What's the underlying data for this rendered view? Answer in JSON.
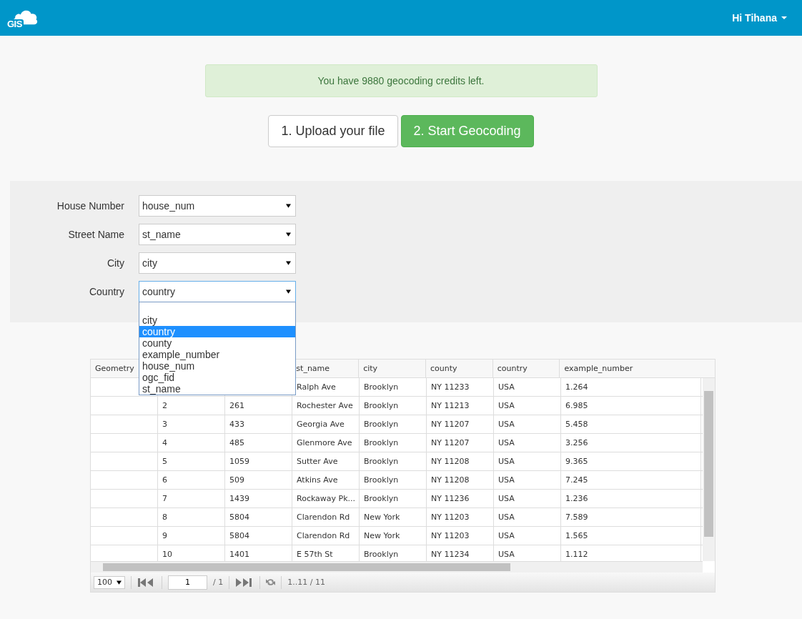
{
  "navbar": {
    "logo": "GIS",
    "user_menu": "Hi Tihana"
  },
  "alert": {
    "text": "You have 9880 geocoding credits left."
  },
  "steps": [
    {
      "label": "1. Upload your file",
      "selected": false
    },
    {
      "label": "2. Start Geocoding",
      "selected": true
    }
  ],
  "form": {
    "fields": [
      {
        "label": "House Number",
        "value": "house_num",
        "focused": false
      },
      {
        "label": "Street Name",
        "value": "st_name",
        "focused": false
      },
      {
        "label": "City",
        "value": "city",
        "focused": false
      },
      {
        "label": "Country",
        "value": "country",
        "focused": true
      }
    ],
    "open_dropdown": {
      "options": [
        {
          "label": "city",
          "selected": false
        },
        {
          "label": "country",
          "selected": true
        },
        {
          "label": "county",
          "selected": false
        },
        {
          "label": "example_number",
          "selected": false
        },
        {
          "label": "house_num",
          "selected": false
        },
        {
          "label": "ogc_fid",
          "selected": false
        },
        {
          "label": "st_name",
          "selected": false
        }
      ]
    }
  },
  "table": {
    "columns": [
      "Geometry",
      null,
      null,
      "st_name",
      "city",
      "county",
      "country",
      "example_number"
    ],
    "rows": [
      [
        null,
        null,
        null,
        "Ralph Ave",
        "Brooklyn",
        "NY 11233",
        "USA",
        "1.264"
      ],
      [
        null,
        "2",
        "261",
        "Rochester Ave",
        "Brooklyn",
        "NY 11213",
        "USA",
        "6.985"
      ],
      [
        null,
        "3",
        "433",
        "Georgia Ave",
        "Brooklyn",
        "NY 11207",
        "USA",
        "5.458"
      ],
      [
        null,
        "4",
        "485",
        "Glenmore Ave",
        "Brooklyn",
        "NY 11207",
        "USA",
        "3.256"
      ],
      [
        null,
        "5",
        "1059",
        "Sutter Ave",
        "Brooklyn",
        "NY 11208",
        "USA",
        "9.365"
      ],
      [
        null,
        "6",
        "509",
        "Atkins Ave",
        "Brooklyn",
        "NY 11208",
        "USA",
        "7.245"
      ],
      [
        null,
        "7",
        "1439",
        "Rockaway Pk...",
        "Brooklyn",
        "NY 11236",
        "USA",
        "1.236"
      ],
      [
        null,
        "8",
        "5804",
        "Clarendon Rd",
        "New York",
        "NY 11203",
        "USA",
        "7.589"
      ],
      [
        null,
        "9",
        "5804",
        "Clarendon Rd",
        "New York",
        "NY 11203",
        "USA",
        "1.565"
      ],
      [
        null,
        "10",
        "1401",
        "E 57th St",
        "Brooklyn",
        "NY 11234",
        "USA",
        "1.112"
      ]
    ],
    "pager": {
      "page_size": "100",
      "page": "1",
      "page_total": "/ 1",
      "range": "1..11 / 11"
    }
  }
}
